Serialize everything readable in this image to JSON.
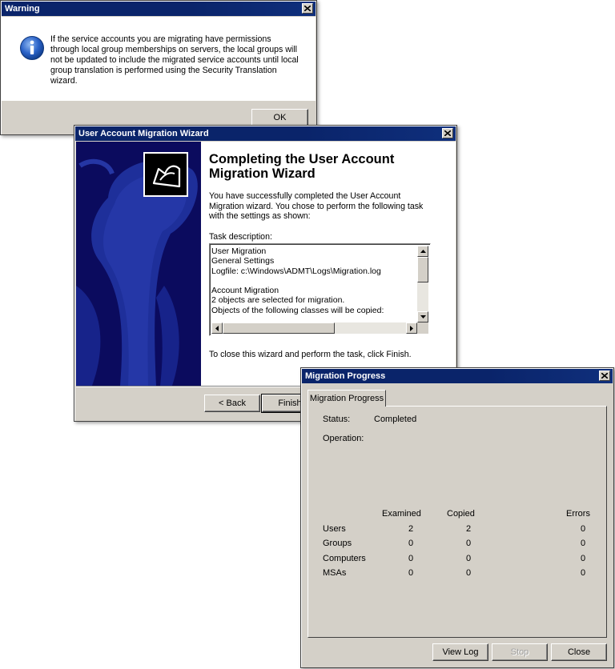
{
  "warning": {
    "title": "Warning",
    "message": "If the service accounts you are migrating have permissions through local group memberships on servers, the local groups will not be updated to include the migrated service accounts until local group translation is performed using the Security Translation wizard.",
    "ok_label": "OK",
    "icon": "info-icon"
  },
  "wizard": {
    "title": "User Account Migration Wizard",
    "heading": "Completing the User Account Migration Wizard",
    "intro": "You have successfully completed the User Account Migration wizard. You chose to perform the following task with the settings as shown:",
    "task_label": "Task description:",
    "task_lines": [
      "User Migration",
      "General Settings",
      "Logfile: c:\\Windows\\ADMT\\Logs\\Migration.log",
      "",
      "Account Migration",
      "2 objects are selected for migration.",
      "Objects of the following classes will be copied:"
    ],
    "close_text": "To close this wizard and perform the task, click Finish.",
    "back_label": "< Back",
    "finish_label": "Finish"
  },
  "progress": {
    "title": "Migration Progress",
    "tab_label": "Migration Progress",
    "status_label": "Status:",
    "status_value": "Completed",
    "operation_label": "Operation:",
    "operation_value": "",
    "columns": [
      "Examined",
      "Copied",
      "Errors"
    ],
    "rows": [
      {
        "name": "Users",
        "examined": "2",
        "copied": "2",
        "errors": "0"
      },
      {
        "name": "Groups",
        "examined": "0",
        "copied": "0",
        "errors": "0"
      },
      {
        "name": "Computers",
        "examined": "0",
        "copied": "0",
        "errors": "0"
      },
      {
        "name": "MSAs",
        "examined": "0",
        "copied": "0",
        "errors": "0"
      }
    ],
    "view_log_label": "View Log",
    "stop_label": "Stop",
    "close_label": "Close"
  },
  "colors": {
    "titlebar": "#0a246a",
    "dialog_face": "#d4d0c8",
    "wizard_banner": "#0b0b5e"
  }
}
